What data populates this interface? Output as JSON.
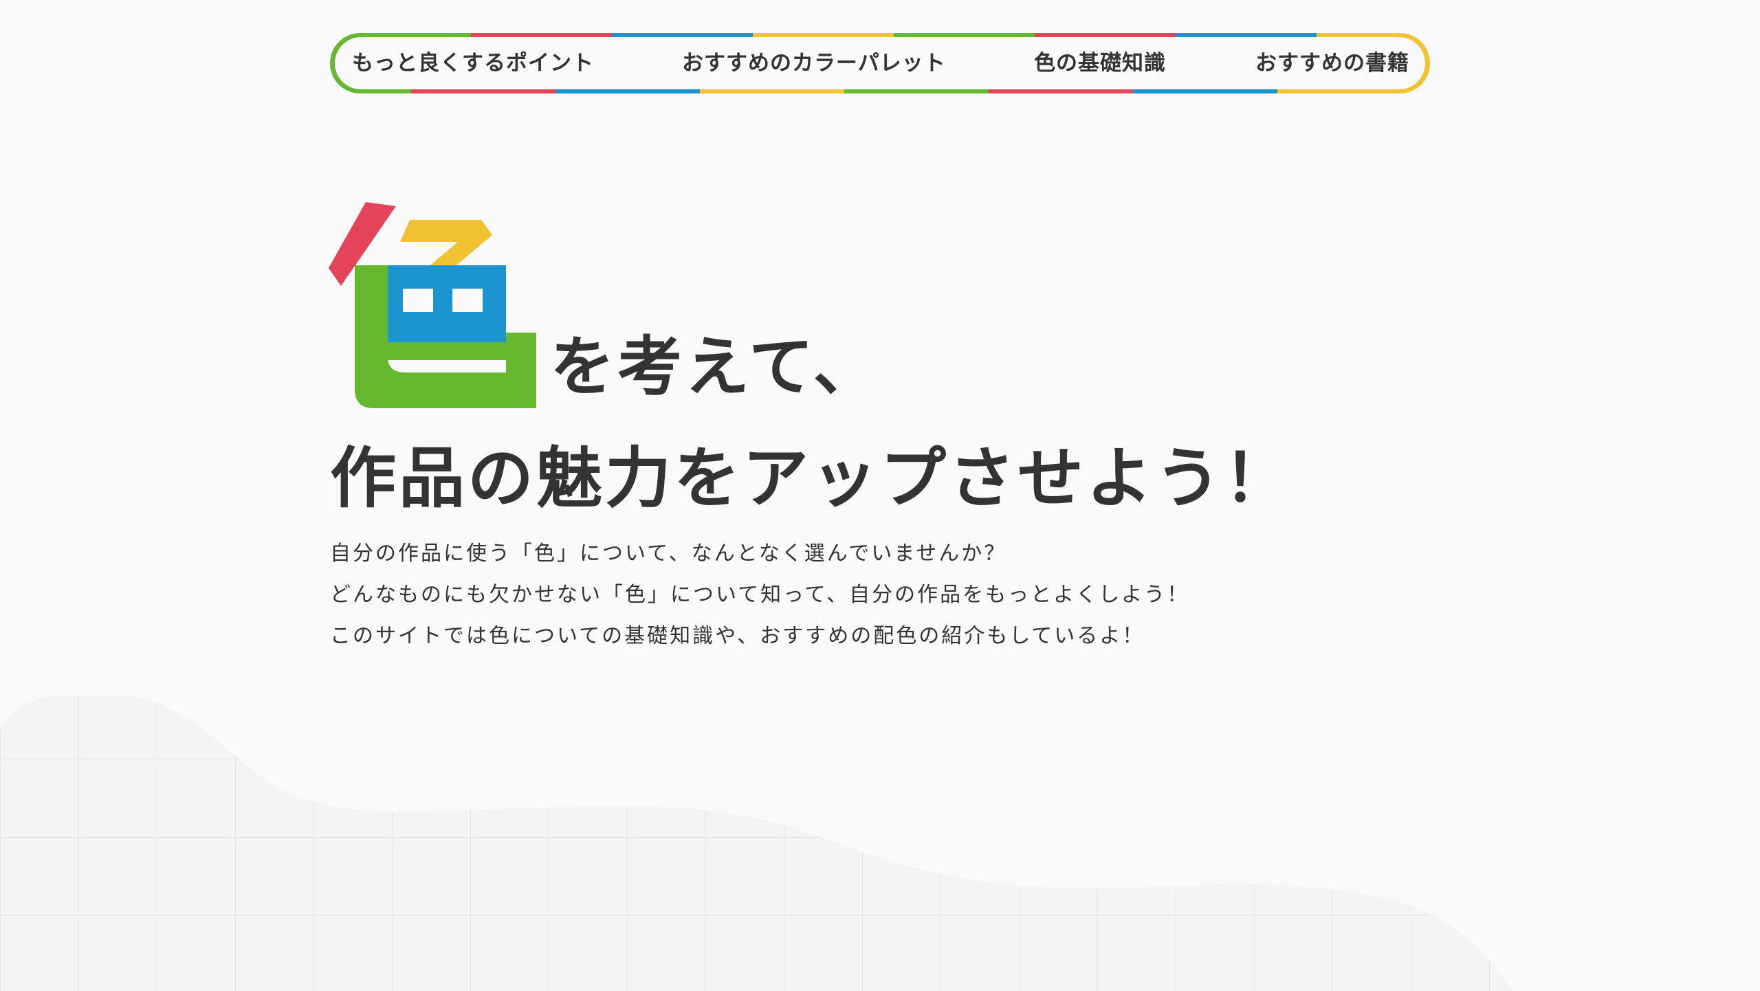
{
  "nav": {
    "items": [
      {
        "label": "もっと良くするポイント"
      },
      {
        "label": "おすすめのカラーパレット"
      },
      {
        "label": "色の基礎知識"
      },
      {
        "label": "おすすめの書籍"
      }
    ]
  },
  "hero": {
    "mark_char": "色",
    "line1": "を考えて、",
    "line2": "作品の魅力をアップさせよう！"
  },
  "intro": {
    "lines": [
      "自分の作品に使う「色」について、なんとなく選んでいませんか？",
      "どんなものにも欠かせない「色」について知って、自分の作品をもっとよくしよう！",
      "このサイトでは色についての基礎知識や、おすすめの配色の紹介もしているよ！"
    ]
  },
  "colors": {
    "red": "#e5435a",
    "yellow": "#f1c232",
    "blue": "#1b94cf",
    "green": "#66b92e",
    "text": "#333333",
    "background": "#fafafa",
    "grid": "#e6e6e6"
  }
}
